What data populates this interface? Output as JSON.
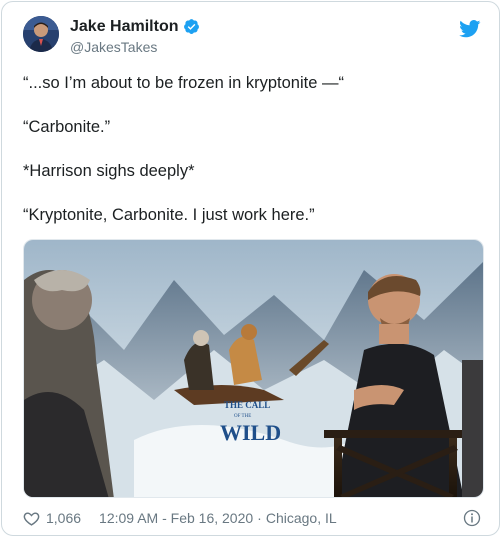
{
  "author": {
    "name": "Jake Hamilton",
    "handle": "@JakesTakes",
    "verified": true
  },
  "tweet": {
    "lines": [
      "“...so I’m about to be frozen in kryptonite —“",
      "“Carbonite.”",
      "*Harrison sighs deeply*",
      "“Kryptonite, Carbonite. I just work here.”"
    ]
  },
  "media": {
    "poster_title_line1": "THE CALL",
    "poster_title_small": "OF THE",
    "poster_title_line2": "WILD"
  },
  "footer": {
    "likes": "1,066",
    "time": "12:09 AM - Feb 16, 2020",
    "separator": "·",
    "location": "Chicago, IL"
  },
  "colors": {
    "twitter_blue": "#1da1f2",
    "heart_gray": "#697882",
    "text": "#1c2022",
    "muted": "#697882"
  },
  "icons": {
    "brand": "twitter-bird-icon",
    "verified": "verified-badge-icon",
    "like": "heart-icon",
    "info": "info-icon"
  }
}
